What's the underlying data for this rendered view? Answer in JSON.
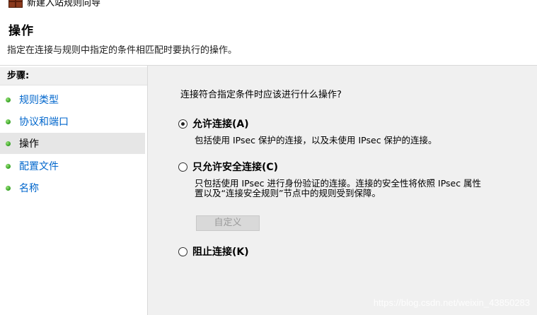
{
  "window": {
    "title": "新建入站规则向导"
  },
  "header": {
    "title": "操作",
    "subtitle": "指定在连接与规则中指定的条件相匹配时要执行的操作。"
  },
  "sidebar": {
    "heading": "步骤:",
    "items": [
      {
        "label": "规则类型",
        "active": false
      },
      {
        "label": "协议和端口",
        "active": false
      },
      {
        "label": "操作",
        "active": true
      },
      {
        "label": "配置文件",
        "active": false
      },
      {
        "label": "名称",
        "active": false
      }
    ]
  },
  "main": {
    "question": "连接符合指定条件时应该进行什么操作?",
    "options": [
      {
        "label": "允许连接(A)",
        "selected": true,
        "description": "包括使用 IPsec 保护的连接，以及未使用 IPsec 保护的连接。"
      },
      {
        "label": "只允许安全连接(C)",
        "selected": false,
        "description_line1": "只包括使用 IPsec 进行身份验证的连接。连接的安全性将依照 IPsec 属性",
        "description_line2": "置以及“连接安全规则”节点中的规则受到保障。",
        "button_label": "自定义"
      },
      {
        "label": "阻止连接(K)",
        "selected": false
      }
    ]
  },
  "watermark": "https://blog.csdn.net/weixin_43850283",
  "colors": {
    "link": "#0066cc",
    "content_bg": "#f0f0f0",
    "active_step_bg": "#e6e6e6"
  }
}
